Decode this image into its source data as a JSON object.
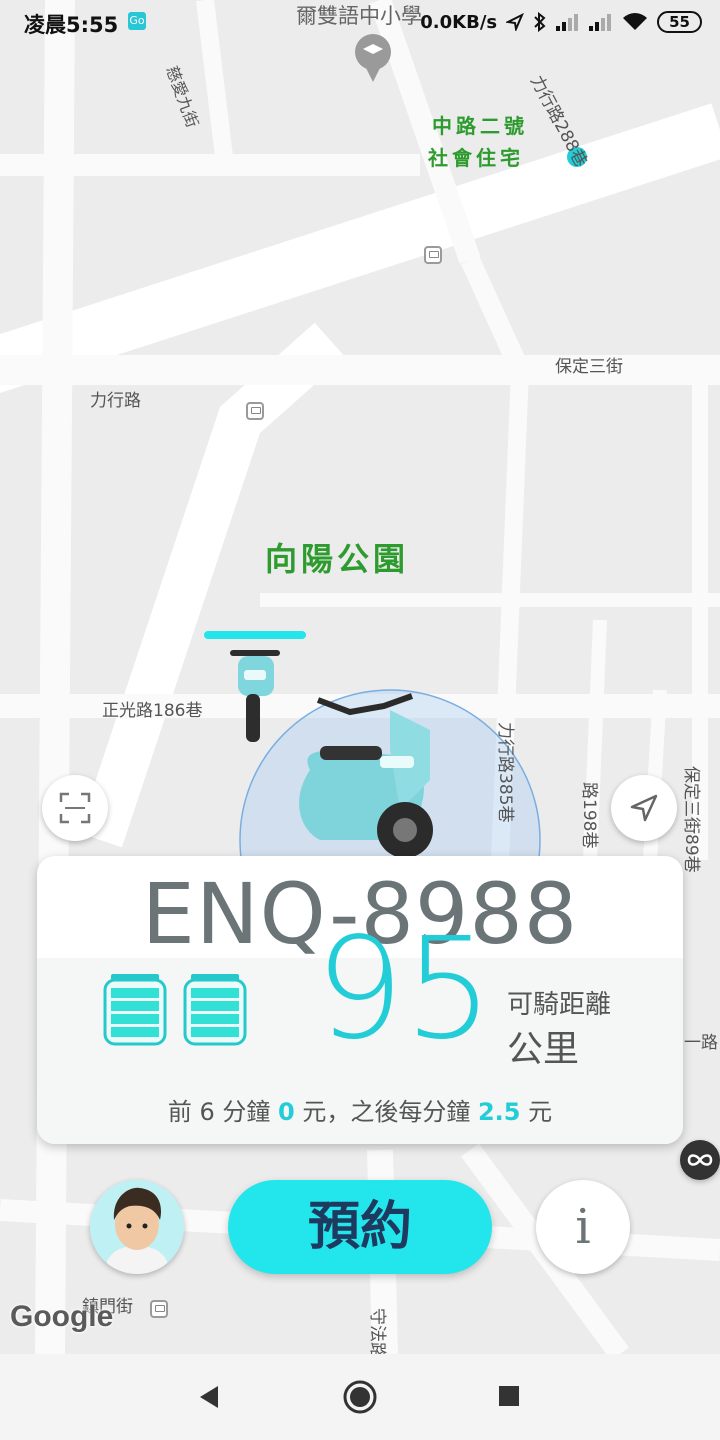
{
  "status_bar": {
    "time": "凌晨5:55",
    "app_badge": "Go",
    "net_speed": "0.0KB/s",
    "battery": "55"
  },
  "map": {
    "labels": {
      "school": "爾雙語中小學",
      "street_cih": "慈愛九街",
      "street_lixing288": "力行路288巷",
      "housing_line1": "中路二號",
      "housing_line2": "社會住宅",
      "baoding3": "保定三街",
      "lixing": "力行路",
      "park": "向陽公園",
      "zhengguang186": "正光路186巷",
      "lixing385": "力行路385巷",
      "lane198": "路198巷",
      "baoding3_89": "保定三街89巷",
      "road_right": "一路",
      "zhenmen": "鎮門街",
      "shoufa": "守法路"
    },
    "google_logo": "Google"
  },
  "vehicle": {
    "plate": "ENQ-8988",
    "range": "95",
    "range_label": "可騎距離",
    "range_unit": "公里",
    "battery_level": 1.0
  },
  "pricing": {
    "p1": "前 6 分鐘 ",
    "free_price": "0",
    "p2": " 元，之後每分鐘 ",
    "rate": "2.5",
    "p3": " 元"
  },
  "actions": {
    "reserve_label": "預約",
    "info_label": "i"
  },
  "colors": {
    "accent": "#22cdd7",
    "reserve_bg": "#22e6ec",
    "reserve_text": "#1e3a5f",
    "park_label": "#2e9b2e"
  }
}
